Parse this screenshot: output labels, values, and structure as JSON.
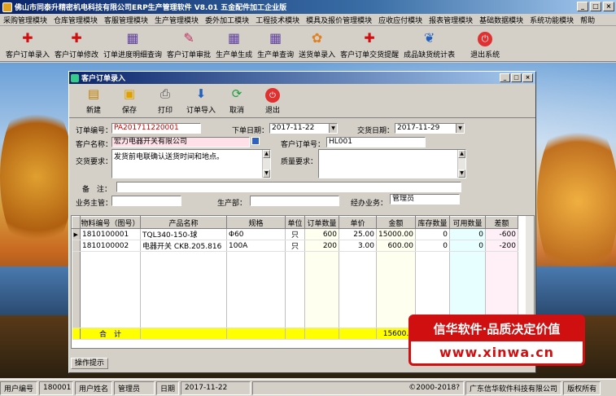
{
  "app": {
    "title": "佛山市同泰升精密机电科技有限公司ERP生产管理软件  V8.01  五金配件加工企业版"
  },
  "menu": [
    "采购管理模块",
    "仓库管理模块",
    "客服管理模块",
    "生产管理模块",
    "委外加工模块",
    "工程技术模块",
    "模具及报价管理模块",
    "应收应付模块",
    "报表管理模块",
    "基础数据模块",
    "系统功能模块",
    "帮助"
  ],
  "toolbar": [
    {
      "label": "客户订单录入",
      "icon": "pdf-icon"
    },
    {
      "label": "客户订单修改",
      "icon": "pdf-icon"
    },
    {
      "label": "订单进度明细查询",
      "icon": "chart-icon"
    },
    {
      "label": "客户订单审批",
      "icon": "pen-icon"
    },
    {
      "label": "生产单生成",
      "icon": "chart-icon"
    },
    {
      "label": "生产单查询",
      "icon": "chart-icon"
    },
    {
      "label": "送货单录入",
      "icon": "flower-icon"
    },
    {
      "label": "客户订单交货提醒",
      "icon": "pdf-icon"
    },
    {
      "label": "成品缺货统计表",
      "icon": "feather-icon"
    },
    {
      "label": "退出系统",
      "icon": "exit-icon"
    }
  ],
  "window": {
    "title": "客户订单录入",
    "toolbar": [
      "新建",
      "保存",
      "打印",
      "订单导入",
      "取消",
      "退出"
    ]
  },
  "form": {
    "order_no_label": "订单编号：",
    "order_no": "PA201711220001",
    "order_date_label": "下单日期：",
    "order_date": "2017-11-22",
    "delivery_date_label": "交货日期：",
    "delivery_date": "2017-11-29",
    "customer_label": "客户名称：",
    "customer": "宏力电器开关有限公司",
    "customer_order_label": "客户订单号：",
    "customer_order": "HL001",
    "delivery_req_label": "交货要求：",
    "delivery_req": "发货前电联确认送货时间和地点。",
    "quality_req_label": "质量要求：",
    "remark_label": "备　注：",
    "manager_label": "业务主管：",
    "dept_label": "生产部：",
    "agent_label": "经办业务：",
    "agent": "管理员"
  },
  "grid": {
    "columns": [
      "物料编号（图号）",
      "产品名称",
      "规格",
      "单位",
      "订单数量",
      "单价",
      "金额",
      "库存数量",
      "可用数量",
      "差额"
    ],
    "rows": [
      [
        "1810100001",
        "TQL340-150-球",
        "Φ60",
        "只",
        "600",
        "25.00",
        "15000.00",
        "0",
        "0",
        "-600"
      ],
      [
        "1810100002",
        "电器开关 CKB.205.816",
        "100A",
        "只",
        "200",
        "3.00",
        "600.00",
        "0",
        "0",
        "-200"
      ]
    ],
    "total_label": "合　计",
    "total_amount": "15600.0"
  },
  "tip_tab": "操作提示",
  "status": {
    "user_no_label": "用户编号",
    "user_no": "180001",
    "user_name_label": "用户姓名",
    "user_name": "管理员",
    "date_label": "日期",
    "date": "2017-11-22",
    "copyright": "©2000-2018?",
    "company": "广东信华软件科技有限公司",
    "rights": "版权所有"
  },
  "banner": {
    "slogan": "信华软件·品质决定价值",
    "url": "www.xinwa.cn"
  },
  "colors": {
    "title_blue": "#0a246a",
    "accent_red": "#d01010",
    "total_yellow": "#ffff00",
    "order_no_red": "#d00000"
  }
}
